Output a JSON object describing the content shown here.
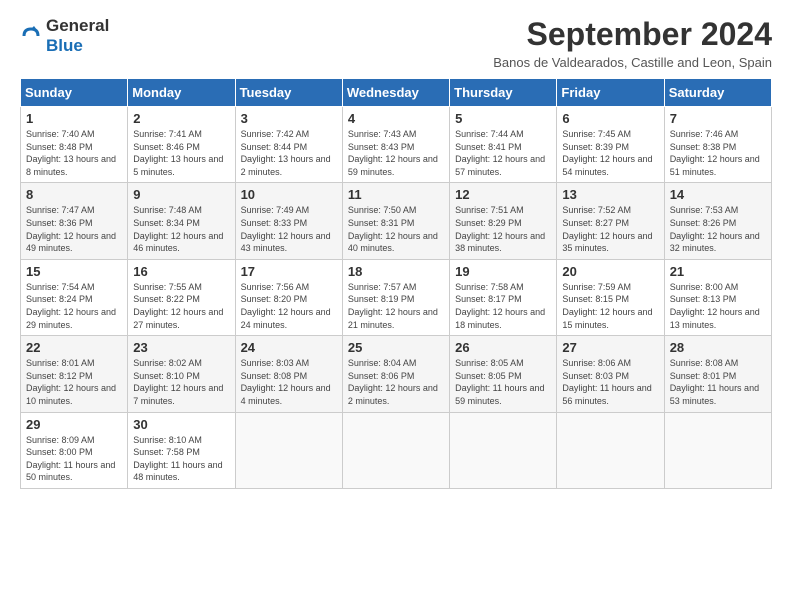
{
  "header": {
    "logo_general": "General",
    "logo_blue": "Blue",
    "title": "September 2024",
    "subtitle": "Banos de Valdearados, Castille and Leon, Spain"
  },
  "days_of_week": [
    "Sunday",
    "Monday",
    "Tuesday",
    "Wednesday",
    "Thursday",
    "Friday",
    "Saturday"
  ],
  "weeks": [
    [
      {
        "day": "1",
        "sunrise": "7:40 AM",
        "sunset": "8:48 PM",
        "daylight": "13 hours and 8 minutes."
      },
      {
        "day": "2",
        "sunrise": "7:41 AM",
        "sunset": "8:46 PM",
        "daylight": "13 hours and 5 minutes."
      },
      {
        "day": "3",
        "sunrise": "7:42 AM",
        "sunset": "8:44 PM",
        "daylight": "13 hours and 2 minutes."
      },
      {
        "day": "4",
        "sunrise": "7:43 AM",
        "sunset": "8:43 PM",
        "daylight": "12 hours and 59 minutes."
      },
      {
        "day": "5",
        "sunrise": "7:44 AM",
        "sunset": "8:41 PM",
        "daylight": "12 hours and 57 minutes."
      },
      {
        "day": "6",
        "sunrise": "7:45 AM",
        "sunset": "8:39 PM",
        "daylight": "12 hours and 54 minutes."
      },
      {
        "day": "7",
        "sunrise": "7:46 AM",
        "sunset": "8:38 PM",
        "daylight": "12 hours and 51 minutes."
      }
    ],
    [
      {
        "day": "8",
        "sunrise": "7:47 AM",
        "sunset": "8:36 PM",
        "daylight": "12 hours and 49 minutes."
      },
      {
        "day": "9",
        "sunrise": "7:48 AM",
        "sunset": "8:34 PM",
        "daylight": "12 hours and 46 minutes."
      },
      {
        "day": "10",
        "sunrise": "7:49 AM",
        "sunset": "8:33 PM",
        "daylight": "12 hours and 43 minutes."
      },
      {
        "day": "11",
        "sunrise": "7:50 AM",
        "sunset": "8:31 PM",
        "daylight": "12 hours and 40 minutes."
      },
      {
        "day": "12",
        "sunrise": "7:51 AM",
        "sunset": "8:29 PM",
        "daylight": "12 hours and 38 minutes."
      },
      {
        "day": "13",
        "sunrise": "7:52 AM",
        "sunset": "8:27 PM",
        "daylight": "12 hours and 35 minutes."
      },
      {
        "day": "14",
        "sunrise": "7:53 AM",
        "sunset": "8:26 PM",
        "daylight": "12 hours and 32 minutes."
      }
    ],
    [
      {
        "day": "15",
        "sunrise": "7:54 AM",
        "sunset": "8:24 PM",
        "daylight": "12 hours and 29 minutes."
      },
      {
        "day": "16",
        "sunrise": "7:55 AM",
        "sunset": "8:22 PM",
        "daylight": "12 hours and 27 minutes."
      },
      {
        "day": "17",
        "sunrise": "7:56 AM",
        "sunset": "8:20 PM",
        "daylight": "12 hours and 24 minutes."
      },
      {
        "day": "18",
        "sunrise": "7:57 AM",
        "sunset": "8:19 PM",
        "daylight": "12 hours and 21 minutes."
      },
      {
        "day": "19",
        "sunrise": "7:58 AM",
        "sunset": "8:17 PM",
        "daylight": "12 hours and 18 minutes."
      },
      {
        "day": "20",
        "sunrise": "7:59 AM",
        "sunset": "8:15 PM",
        "daylight": "12 hours and 15 minutes."
      },
      {
        "day": "21",
        "sunrise": "8:00 AM",
        "sunset": "8:13 PM",
        "daylight": "12 hours and 13 minutes."
      }
    ],
    [
      {
        "day": "22",
        "sunrise": "8:01 AM",
        "sunset": "8:12 PM",
        "daylight": "12 hours and 10 minutes."
      },
      {
        "day": "23",
        "sunrise": "8:02 AM",
        "sunset": "8:10 PM",
        "daylight": "12 hours and 7 minutes."
      },
      {
        "day": "24",
        "sunrise": "8:03 AM",
        "sunset": "8:08 PM",
        "daylight": "12 hours and 4 minutes."
      },
      {
        "day": "25",
        "sunrise": "8:04 AM",
        "sunset": "8:06 PM",
        "daylight": "12 hours and 2 minutes."
      },
      {
        "day": "26",
        "sunrise": "8:05 AM",
        "sunset": "8:05 PM",
        "daylight": "11 hours and 59 minutes."
      },
      {
        "day": "27",
        "sunrise": "8:06 AM",
        "sunset": "8:03 PM",
        "daylight": "11 hours and 56 minutes."
      },
      {
        "day": "28",
        "sunrise": "8:08 AM",
        "sunset": "8:01 PM",
        "daylight": "11 hours and 53 minutes."
      }
    ],
    [
      {
        "day": "29",
        "sunrise": "8:09 AM",
        "sunset": "8:00 PM",
        "daylight": "11 hours and 50 minutes."
      },
      {
        "day": "30",
        "sunrise": "8:10 AM",
        "sunset": "7:58 PM",
        "daylight": "11 hours and 48 minutes."
      },
      null,
      null,
      null,
      null,
      null
    ]
  ]
}
